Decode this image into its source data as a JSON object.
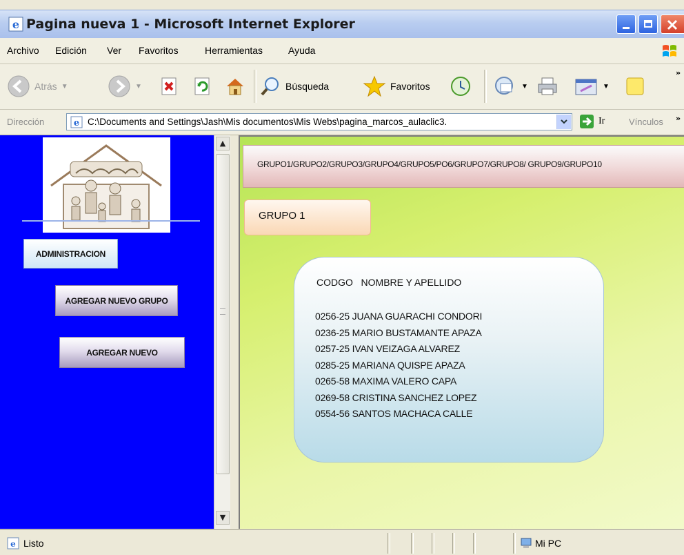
{
  "window": {
    "title": "Pagina nueva 1 - Microsoft Internet Explorer"
  },
  "menu": {
    "items": [
      "Archivo",
      "Edición",
      "Ver",
      "Favoritos",
      "Herramientas",
      "Ayuda"
    ]
  },
  "toolbar": {
    "back": "Atrás",
    "search": "Búsqueda",
    "favorites": "Favoritos"
  },
  "address": {
    "label": "Dirección",
    "value": "C:\\Documents and Settings\\Jash\\Mis documentos\\Mis Webs\\pagina_marcos_aulaclic3.",
    "go": "Ir",
    "links": "Vínculos"
  },
  "left_nav": {
    "buttons": [
      "ADMINISTRACION",
      "AGREGAR NUEVO GRUPO",
      "AGREGAR NUEVO"
    ]
  },
  "main": {
    "groups_bar": "GRUPO1/GRUPO2/GRUPO3/GRUPO4/GRUPO5/PO6/GRUPO7/GRUPO8/ GRUPO9/GRUPO10",
    "group_title": "GRUPO 1",
    "table_header": "CODGO   NOMBRE Y APELLIDO",
    "members": [
      "0256-25 JUANA GUARACHI  CONDORI",
      "0236-25 MARIO BUSTAMANTE APAZA",
      "0257-25 IVAN VEIZAGA ALVAREZ",
      "0285-25 MARIANA QUISPE APAZA",
      "0265-58 MAXIMA VALERO CAPA",
      "0269-58 CRISTINA SANCHEZ LOPEZ",
      "0554-56 SANTOS MACHACA CALLE"
    ]
  },
  "status": {
    "text": "Listo",
    "zone": "Mi PC"
  },
  "colors": {
    "left_frame": "#0000ff",
    "content_green": "#c8ea62",
    "title_bar": "#b9cdf0"
  }
}
